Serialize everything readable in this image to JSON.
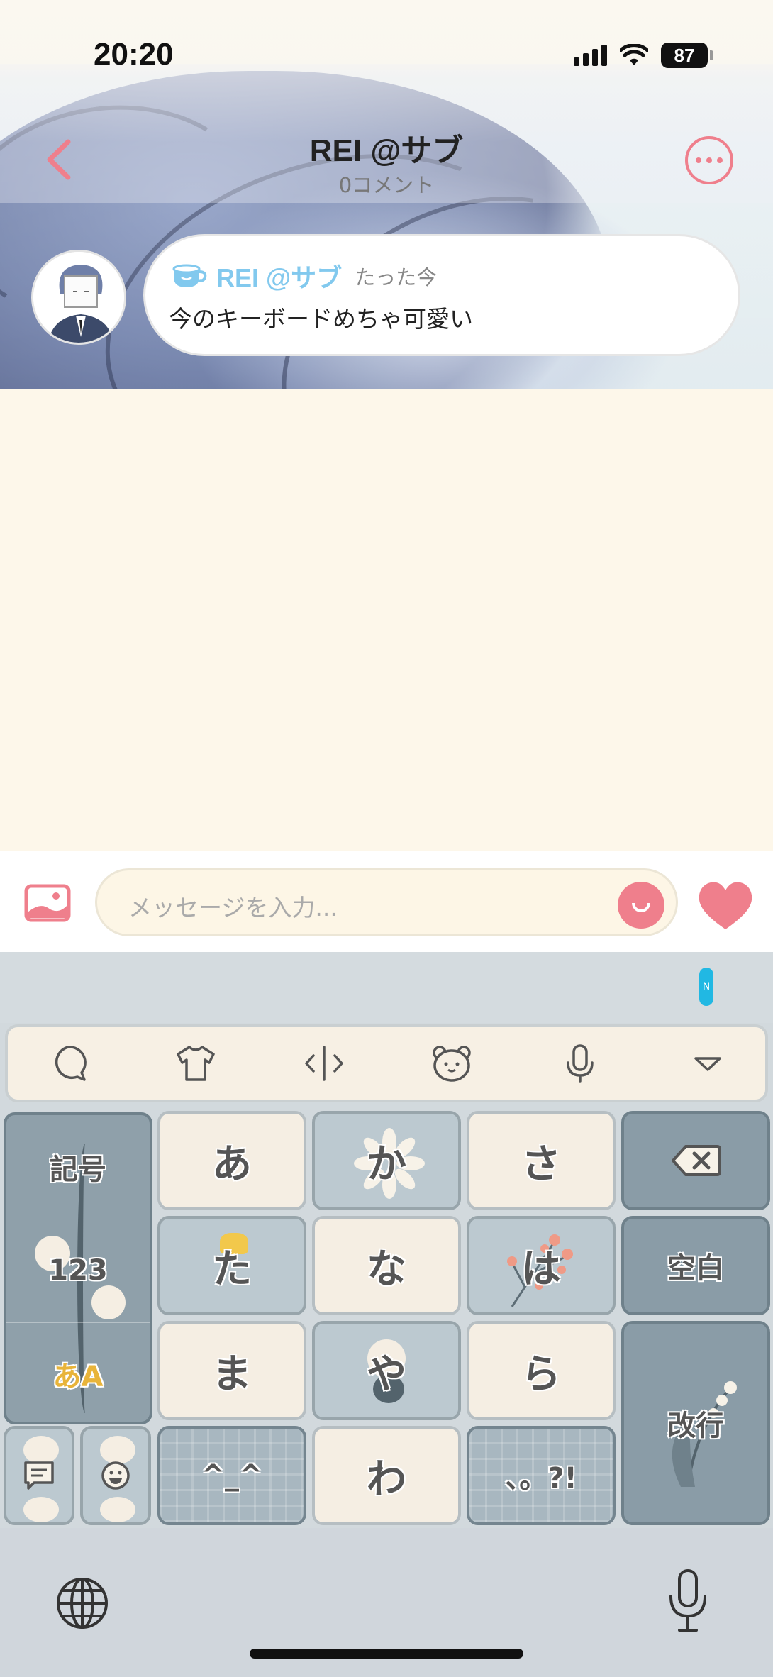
{
  "status_bar": {
    "time": "20:20",
    "battery": "87"
  },
  "nav": {
    "title": "REI @サブ",
    "subtitle": "0コメント"
  },
  "message": {
    "author": "REI @サブ",
    "time": "たった今",
    "text": "今のキーボードめちゃ可愛い"
  },
  "input": {
    "placeholder": "メッセージを入力..."
  },
  "keyboard": {
    "side_keys": [
      "記号",
      "123",
      "あA"
    ],
    "keys": {
      "a": "あ",
      "ka": "か",
      "sa": "さ",
      "ta": "た",
      "na": "な",
      "ha": "は",
      "ma": "ま",
      "ya": "や",
      "ra": "ら",
      "kaomoji": "^_^",
      "wa": "わ",
      "punct": "、。?!",
      "space": "空白",
      "enter": "改行"
    },
    "toolbar_icons": [
      "chat-bubble-icon",
      "shirt-icon",
      "cursor-move-icon",
      "bear-face-icon",
      "microphone-icon",
      "collapse-triangle-icon"
    ]
  },
  "colors": {
    "accent_pink": "#ef7f8c",
    "name_blue": "#82c9ee"
  }
}
